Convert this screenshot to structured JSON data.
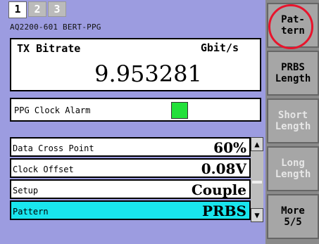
{
  "tabs": [
    "1",
    "2",
    "3"
  ],
  "device_label": "AQ2200-601 BERT-PPG",
  "bitrate": {
    "label": "TX Bitrate",
    "unit": "Gbit/s",
    "value": "9.953281"
  },
  "alarm": {
    "label": "PPG Clock Alarm",
    "status_color": "#22e03a"
  },
  "params": [
    {
      "label": "Data Cross Point",
      "value": "60%"
    },
    {
      "label": "Clock Offset",
      "value": "0.08V"
    },
    {
      "label": "Setup",
      "value": "Couple"
    },
    {
      "label": "Pattern",
      "value": "PRBS"
    }
  ],
  "softkeys": [
    {
      "label": "Pat-\ntern"
    },
    {
      "label": "PRBS\nLength"
    },
    {
      "label": "Short\nLength"
    },
    {
      "label": "Long\nLength"
    },
    {
      "label": "More\n5/5"
    }
  ],
  "scrollbar": {
    "up": "▲",
    "down": "▼"
  }
}
